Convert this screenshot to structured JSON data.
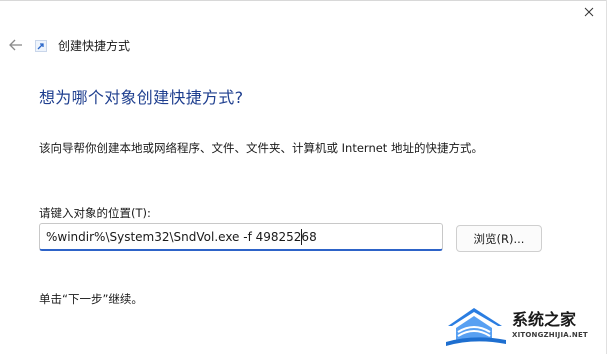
{
  "window": {
    "title": "创建快捷方式"
  },
  "page": {
    "heading": "想为哪个对象创建快捷方式?",
    "description": "该向导帮你创建本地或网络程序、文件、文件夹、计算机或 Internet 地址的快捷方式。",
    "location_label": "请键入对象的位置(T):",
    "location_value": "%windir%\\System32\\SndVol.exe -f 49825268",
    "browse_label": "浏览(R)...",
    "footer_hint": "单击“下一步”继续。"
  },
  "watermark": {
    "site_name": "系统之家",
    "domain": "XITONGZHIJIA.NET"
  },
  "colors": {
    "heading": "#1f3f8f",
    "input_focus": "#2d63c8",
    "watermark_blue": "#2a7de1"
  },
  "icons": {
    "close": "close-icon",
    "back": "arrow-left-icon",
    "wizard": "shortcut-icon",
    "watermark_logo": "house-logo-icon"
  }
}
